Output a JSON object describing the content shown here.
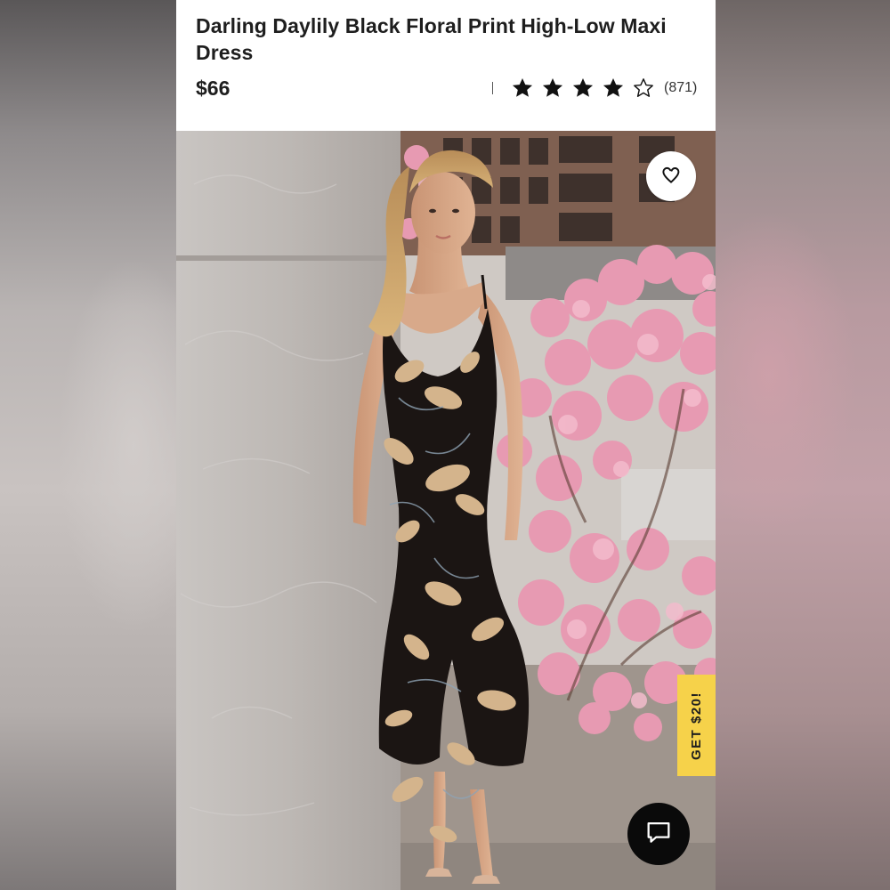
{
  "product": {
    "title": "Darling Daylily Black Floral Print High-Low Maxi Dress",
    "price": "$66",
    "rating": 4,
    "rating_max": 5,
    "review_count": "(871)"
  },
  "actions": {
    "favorite_icon": "heart-outline-icon",
    "promo_label": "GET $20!",
    "chat_icon": "chat-bubble-icon"
  },
  "colors": {
    "promo_bg": "#f6d24a",
    "chat_bg": "#0a0a0a",
    "dress": "#1b1513",
    "print": "#d4b48c",
    "blossom": "#e79ab2"
  }
}
